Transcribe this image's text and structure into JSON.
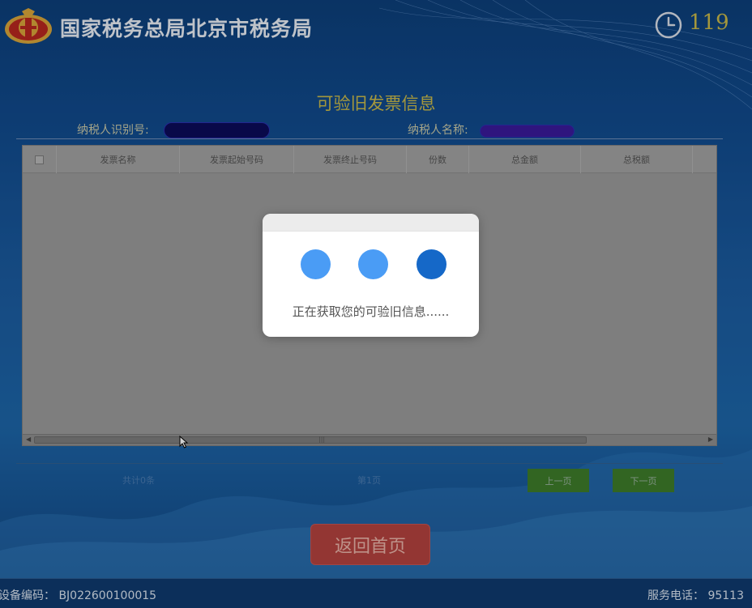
{
  "header": {
    "org_title": "国家税务总局北京市税务局",
    "countdown": "119",
    "emblem_icon": "tax-emblem-icon",
    "clock_icon": "clock-icon"
  },
  "page": {
    "title": "可验旧发票信息",
    "taxpayer_id_label": "纳税人识别号:",
    "taxpayer_name_label": "纳税人名称:"
  },
  "table": {
    "columns": [
      "发票名称",
      "发票起始号码",
      "发票终止号码",
      "份数",
      "总金额",
      "总税额"
    ],
    "rows": []
  },
  "pager": {
    "total": "共计0条",
    "page": "第1页",
    "prev_label": "上一页",
    "next_label": "下一页"
  },
  "home_button": "返回首页",
  "status": {
    "device_code": "设备编码： BJ022600100015",
    "service_phone": "服务电话： 95113"
  },
  "loading_modal": {
    "message": "正在获取您的可验旧信息......"
  },
  "colors": {
    "accent_gold": "#c9b94a",
    "home_button": "#b4423f",
    "pager_button": "#3e7c2a",
    "loading_dot": "#4a9cf5",
    "loading_dot_active": "#1568c8"
  }
}
